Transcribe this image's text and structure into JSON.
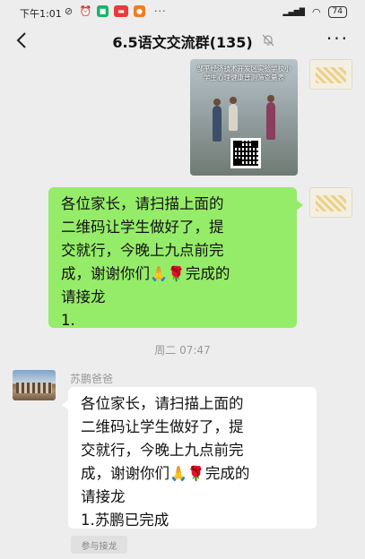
{
  "status_bar": {
    "time": "下午1:01",
    "battery": "74",
    "dots": "···"
  },
  "nav": {
    "title": "6.5语文交流群(135)",
    "back_icon": "chevron-left-icon",
    "mute_icon": "bell-off-icon",
    "more_label": "···"
  },
  "messages": {
    "poster_text": "邹平经济技术开发区实验学校小学生心理健康普测筛查量表",
    "self_text": {
      "line1": "各位家长，请扫描上面的",
      "line2": "二维码让学生做好了，提",
      "line3": "交就行，今晚上九点前完",
      "line4_a": "成，谢谢你们",
      "line4_b": "完成的",
      "line5": "请接龙",
      "line6": "1."
    },
    "timestamp": "周二 07:47",
    "sender_name": "苏鹏爸爸",
    "other_text": {
      "line1": "各位家长，请扫描上面的",
      "line2": "二维码让学生做好了，提",
      "line3": "交就行，今晚上九点前完",
      "line4_a": "成，谢谢你们",
      "line4_b": "完成的",
      "line5": "请接龙",
      "line6": "1.苏鹏已完成"
    },
    "jielong_button": "参与接龙"
  },
  "colors": {
    "self_bubble": "#95ec69",
    "background": "#ededed"
  }
}
